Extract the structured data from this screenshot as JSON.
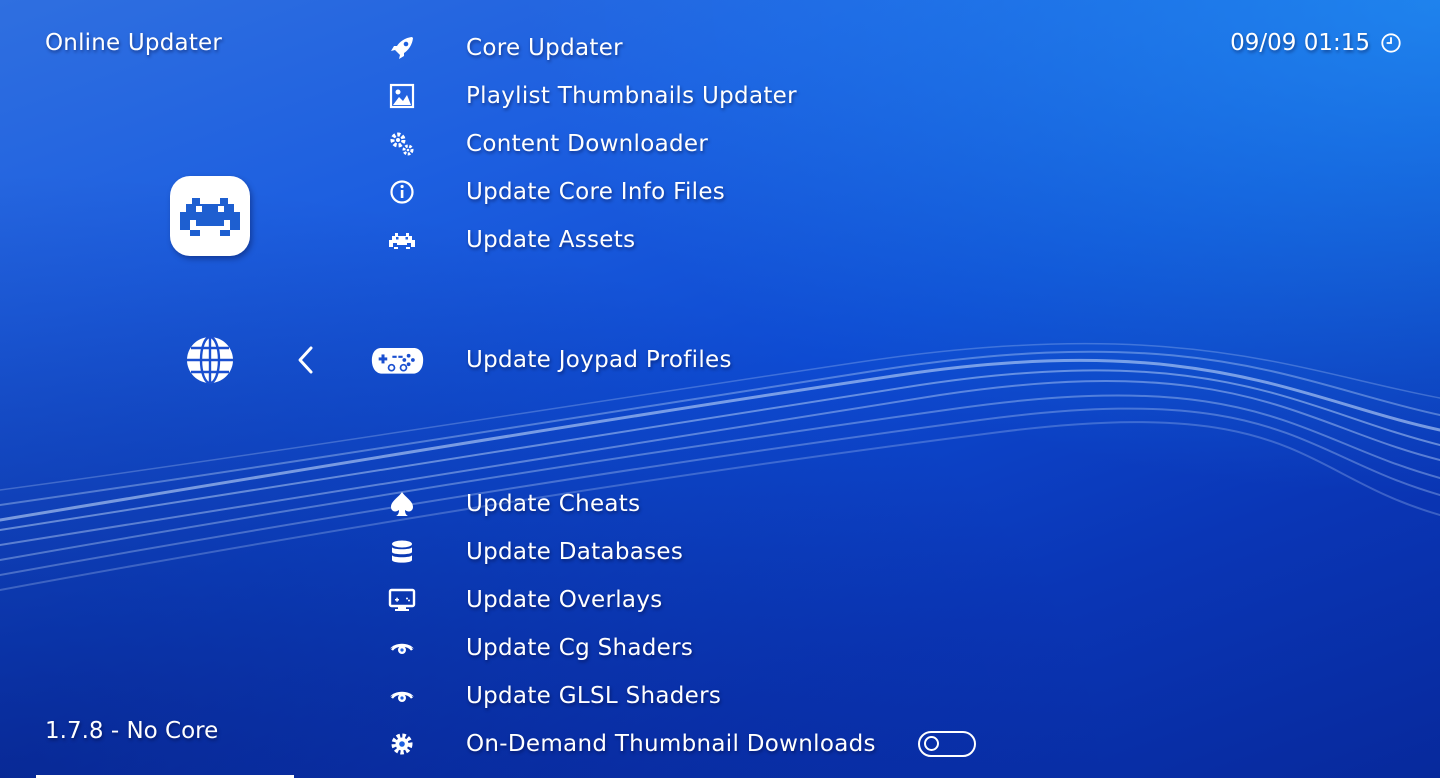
{
  "header": {
    "title": "Online Updater",
    "clock": "09/09 01:15"
  },
  "menu": {
    "items": [
      {
        "label": "Core Updater",
        "icon": "rocket-icon"
      },
      {
        "label": "Playlist Thumbnails Updater",
        "icon": "image-icon"
      },
      {
        "label": "Content Downloader",
        "icon": "gears-icon"
      },
      {
        "label": "Update Core Info Files",
        "icon": "info-icon"
      },
      {
        "label": "Update Assets",
        "icon": "invader-icon"
      },
      {
        "label": "Update Joypad Profiles",
        "icon": "gamepad-icon",
        "selected": true
      },
      {
        "label": "Update Cheats",
        "icon": "spade-icon"
      },
      {
        "label": "Update Databases",
        "icon": "database-icon"
      },
      {
        "label": "Update Overlays",
        "icon": "monitor-icon"
      },
      {
        "label": "Update Cg Shaders",
        "icon": "eye-icon"
      },
      {
        "label": "Update GLSL Shaders",
        "icon": "eye-icon"
      },
      {
        "label": "On-Demand Thumbnail Downloads",
        "icon": "gear-icon",
        "toggle": "off"
      }
    ]
  },
  "footer": {
    "version": "1.7.8 - No Core"
  },
  "colors": {
    "background_top": "#2f6fe0",
    "background_bottom": "#07299c",
    "text": "#ffffff",
    "logo_accent": "#1e5fd0"
  }
}
